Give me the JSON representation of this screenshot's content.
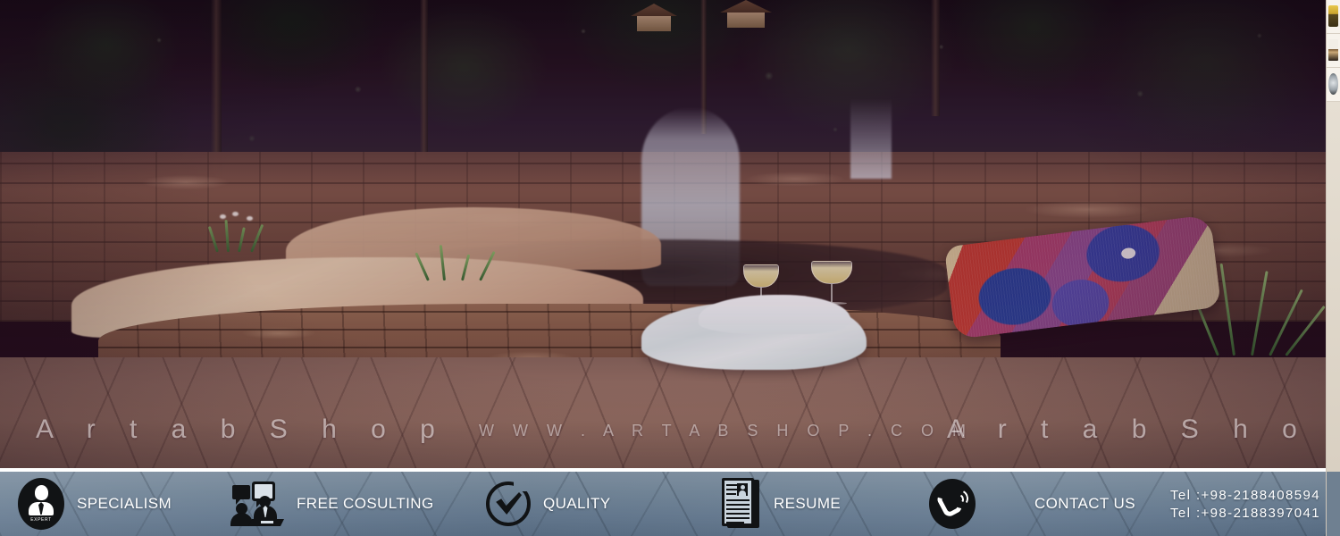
{
  "banner": {
    "alt": "garden-pond-waterfall-stone-patio-photo",
    "watermark_left": "A r t a b   S h o p",
    "watermark_center": "W W W . A R T A B S H O P . C O M",
    "watermark_right": "A r t a b   S h o p"
  },
  "footer": {
    "features": [
      {
        "icon": "expert-badge-icon",
        "label": "SPECIALISM",
        "badge_text": "EXPERT"
      },
      {
        "icon": "consulting-people-icon",
        "label": "FREE COSULTING"
      },
      {
        "icon": "checkmark-circle-icon",
        "label": "QUALITY"
      },
      {
        "icon": "resume-document-icon",
        "label": "RESUME"
      },
      {
        "icon": "phone-call-icon",
        "label": "CONTACT US"
      }
    ],
    "contact": {
      "tel_1": "Tel :+98-2188408594",
      "tel_2": "Tel :+98-2188397041"
    }
  },
  "sidebar_strip": {
    "thumbnails": [
      {
        "name": "product-thumb-lantern"
      },
      {
        "name": "product-thumb-bench"
      },
      {
        "name": "product-thumb-sphere"
      }
    ]
  },
  "colors": {
    "footer_top": "#7b8b9c",
    "footer_bottom": "#55697f",
    "icon_dark": "#111315",
    "text_white": "#ffffff",
    "divider": "#ffffff"
  }
}
